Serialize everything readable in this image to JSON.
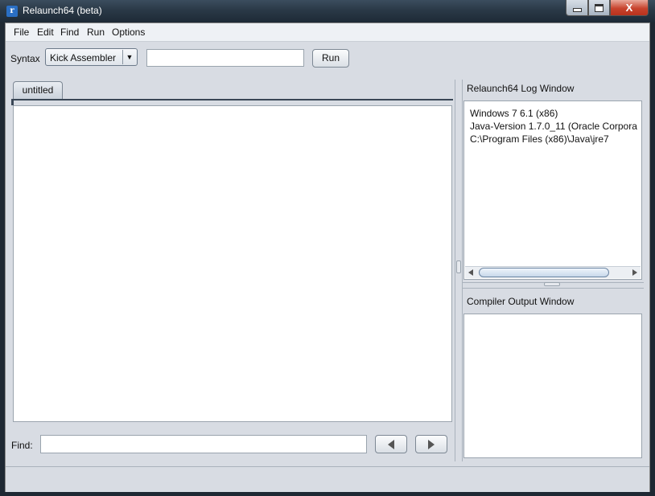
{
  "window": {
    "title": "Relaunch64 (beta)",
    "close_glyph": "X"
  },
  "menu": {
    "items": [
      "File",
      "Edit",
      "Find",
      "Run",
      "Options"
    ]
  },
  "toolbar": {
    "syntax_label": "Syntax",
    "syntax_selected": "Kick Assembler",
    "command_value": "",
    "run_label": "Run"
  },
  "editor": {
    "tab_label": "untitled",
    "content": ""
  },
  "find": {
    "label": "Find:",
    "value": ""
  },
  "log": {
    "title": "Relaunch64 Log Window",
    "lines": [
      "Windows 7 6.1 (x86)",
      "Java-Version 1.7.0_11 (Oracle Corpora",
      "C:\\Program Files (x86)\\Java\\jre7"
    ]
  },
  "compiler": {
    "title": "Compiler Output Window",
    "content": ""
  },
  "icons": {
    "app": "relaunch64-app-icon",
    "dropdown": "chevron-down-icon",
    "find_prev": "arrow-left-icon",
    "find_next": "arrow-right-icon"
  }
}
